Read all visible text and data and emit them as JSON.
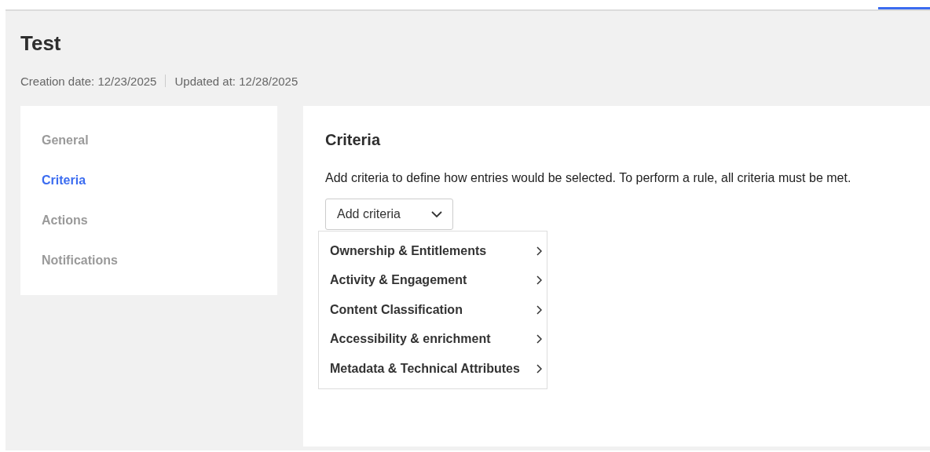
{
  "page": {
    "title": "Test",
    "meta": [
      {
        "label": "Creation date: 12/23/2025"
      },
      {
        "label": "Updated at: 12/28/2025"
      }
    ]
  },
  "sidebar": {
    "items": [
      {
        "label": "General",
        "selected": false
      },
      {
        "label": "Criteria",
        "selected": true
      },
      {
        "label": "Actions",
        "selected": false
      },
      {
        "label": "Notifications",
        "selected": false
      }
    ]
  },
  "main": {
    "heading": "Criteria",
    "description": "Add criteria to define how entries would be selected. To perform a rule, all criteria must be met.",
    "dropdown": {
      "label": "Add criteria",
      "expanded": true,
      "items": [
        {
          "label": "Ownership & Entitlements"
        },
        {
          "label": "Activity & Engagement"
        },
        {
          "label": "Content Classification"
        },
        {
          "label": "Accessibility & enrichment"
        },
        {
          "label": "Metadata & Technical Attributes"
        }
      ]
    }
  }
}
